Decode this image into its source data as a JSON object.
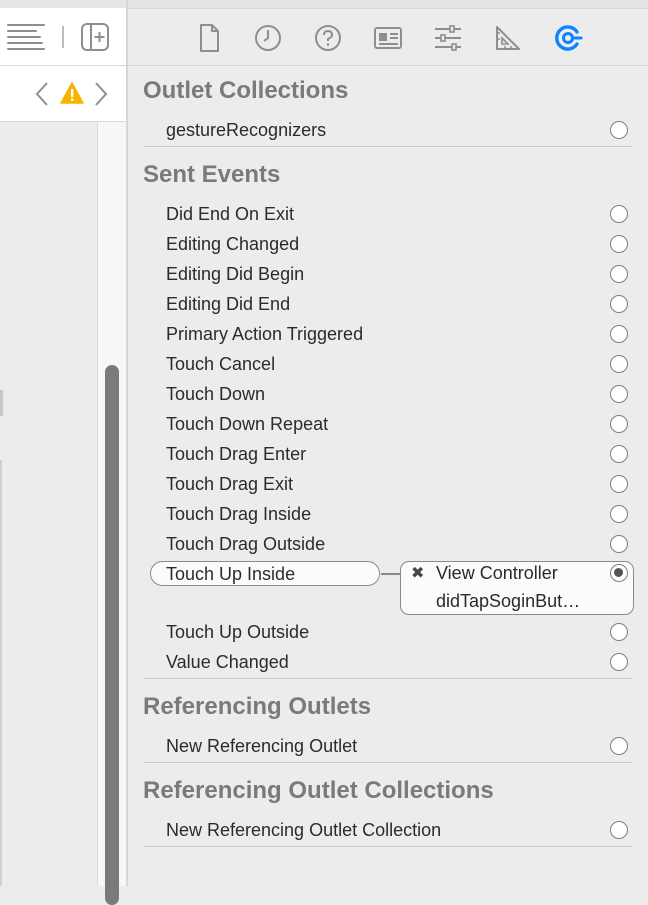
{
  "colors": {
    "accent": "#0a84ff",
    "warning": "#f6b400",
    "section_title": "#7a7a7a",
    "icon_gray": "#8e8e8e"
  },
  "left_pane": {
    "toolbar_icons": [
      "list-lines-icon",
      "add-editor-icon"
    ],
    "nav_icons": [
      "chevron-left-icon",
      "warning-icon",
      "chevron-right-icon"
    ]
  },
  "inspector_tabs": [
    "file-inspector-icon",
    "history-inspector-icon",
    "quick-help-icon",
    "identity-inspector-icon",
    "attributes-inspector-icon",
    "size-inspector-icon",
    "connections-inspector-icon"
  ],
  "sections": {
    "outlet_collections": {
      "title": "Outlet Collections",
      "items": [
        "gestureRecognizers"
      ]
    },
    "sent_events": {
      "title": "Sent Events",
      "items": [
        "Did End On Exit",
        "Editing Changed",
        "Editing Did Begin",
        "Editing Did End",
        "Primary Action Triggered",
        "Touch Cancel",
        "Touch Down",
        "Touch Down Repeat",
        "Touch Drag Enter",
        "Touch Drag Exit",
        "Touch Drag Inside",
        "Touch Drag Outside"
      ],
      "connected": {
        "event": "Touch Up Inside",
        "remove_glyph": "✖",
        "target": "View Controller",
        "action": "didTapSoginBut…"
      },
      "after_items": [
        "Touch Up Outside",
        "Value Changed"
      ]
    },
    "referencing_outlets": {
      "title": "Referencing Outlets",
      "items": [
        "New Referencing Outlet"
      ]
    },
    "referencing_outlet_collections": {
      "title": "Referencing Outlet Collections",
      "items": [
        "New Referencing Outlet Collection"
      ]
    }
  }
}
